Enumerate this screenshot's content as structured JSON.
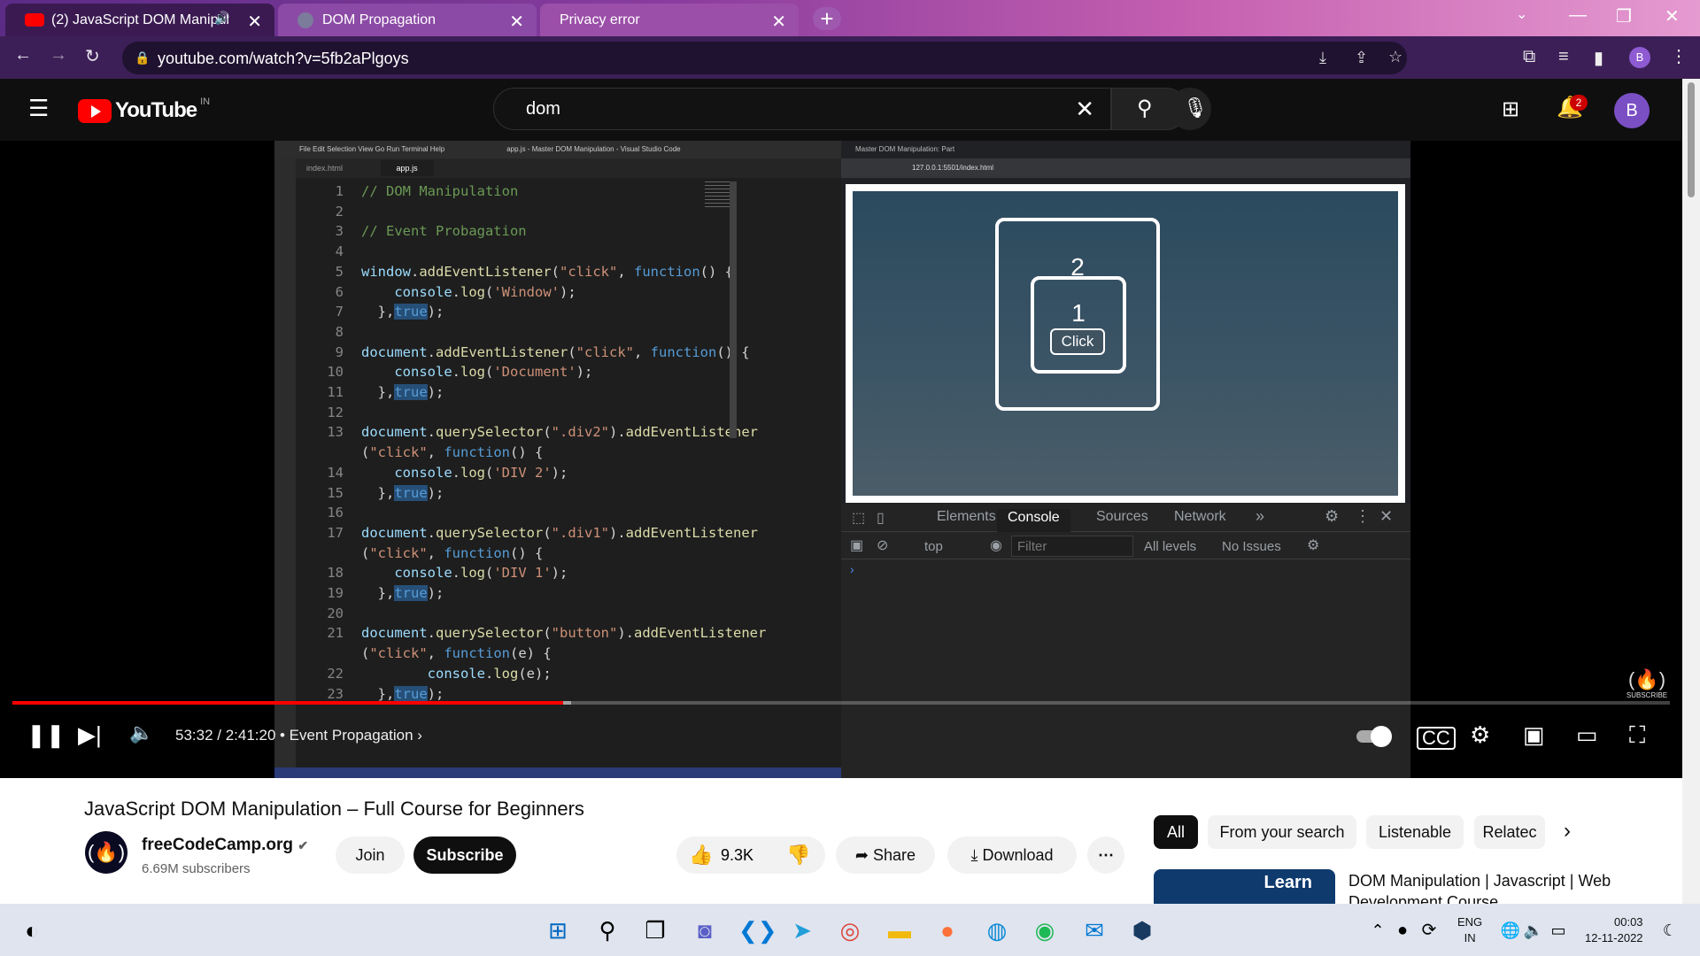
{
  "browser": {
    "tabs": [
      {
        "title": "(2) JavaScript DOM Manipula",
        "active": true
      },
      {
        "title": "DOM Propagation",
        "active": false
      },
      {
        "title": "Privacy error",
        "active": false
      }
    ],
    "url": "youtube.com/watch?v=5fb2aPlgoys",
    "profile_initial": "B"
  },
  "youtube": {
    "logo_text": "YouTube",
    "region": "IN",
    "search_value": "dom",
    "notification_count": "2",
    "avatar_initial": "B"
  },
  "video": {
    "vscode_title": "app.js - Master DOM Manipulation - Visual Studio Code",
    "vscode_menu": "File  Edit  Selection  View  Go  Run  Terminal  Help",
    "vscode_tabs": [
      "index.html",
      "app.js"
    ],
    "code_lines": [
      {
        "n": "1",
        "t": "// DOM Manipulation"
      },
      {
        "n": "2",
        "t": ""
      },
      {
        "n": "3",
        "t": "// Event Probagation"
      },
      {
        "n": "4",
        "t": ""
      },
      {
        "n": "5",
        "t": "window.addEventListener(\"click\", function() {"
      },
      {
        "n": "6",
        "t": "    console.log('Window');"
      },
      {
        "n": "7",
        "t": "  },true);"
      },
      {
        "n": "8",
        "t": ""
      },
      {
        "n": "9",
        "t": "document.addEventListener(\"click\", function() {"
      },
      {
        "n": "10",
        "t": "    console.log('Document');"
      },
      {
        "n": "11",
        "t": "  },true);"
      },
      {
        "n": "12",
        "t": ""
      },
      {
        "n": "13",
        "t": "document.querySelector(\".div2\").addEventListener"
      },
      {
        "n": "",
        "t": "(\"click\", function() {"
      },
      {
        "n": "14",
        "t": "    console.log('DIV 2');"
      },
      {
        "n": "15",
        "t": "  },true);"
      },
      {
        "n": "16",
        "t": ""
      },
      {
        "n": "17",
        "t": "document.querySelector(\".div1\").addEventListener"
      },
      {
        "n": "",
        "t": "(\"click\", function() {"
      },
      {
        "n": "18",
        "t": "    console.log('DIV 1');"
      },
      {
        "n": "19",
        "t": "  },true);"
      },
      {
        "n": "20",
        "t": ""
      },
      {
        "n": "21",
        "t": "document.querySelector(\"button\").addEventListener"
      },
      {
        "n": "",
        "t": "(\"click\", function(e) {"
      },
      {
        "n": "22",
        "t": "        console.log(e);"
      },
      {
        "n": "23",
        "t": "  },true);"
      }
    ],
    "inner_browser_tab": "Master DOM Manipulation: Part",
    "inner_url": "127.0.0.1:5501/index.html",
    "div2_label": "2",
    "div1_label": "1",
    "button_label": "Click",
    "devtools_tabs": [
      "Elements",
      "Console",
      "Sources",
      "Network"
    ],
    "devtools_active_tab": "Console",
    "console_context": "top",
    "console_filter_placeholder": "Filter",
    "console_levels": "All levels",
    "console_issues": "No Issues",
    "watermark": "SUBSCRIBE",
    "time": "53:32 / 2:41:20",
    "chapter": "• Event Propagation",
    "played_fraction": 0.332,
    "buffered_fraction": 0.337
  },
  "meta": {
    "title": "JavaScript DOM Manipulation – Full Course for Beginners",
    "channel": "freeCodeCamp.org",
    "subscribers": "6.69M subscribers",
    "join_label": "Join",
    "subscribe_label": "Subscribe",
    "likes": "9.3K",
    "share_label": "Share",
    "download_label": "Download"
  },
  "sidebar": {
    "chips": [
      "All",
      "From your search",
      "Listenable",
      "Relatec"
    ],
    "related_title": "DOM Manipulation | Javascript | Web Development Course",
    "related_thumb_text": "Learn"
  },
  "taskbar": {
    "lang_line1": "ENG",
    "lang_line2": "IN",
    "time": "00:03",
    "date": "12-11-2022"
  },
  "colors": {
    "yt_red": "#ff0000",
    "accent": "#5b2b86"
  }
}
